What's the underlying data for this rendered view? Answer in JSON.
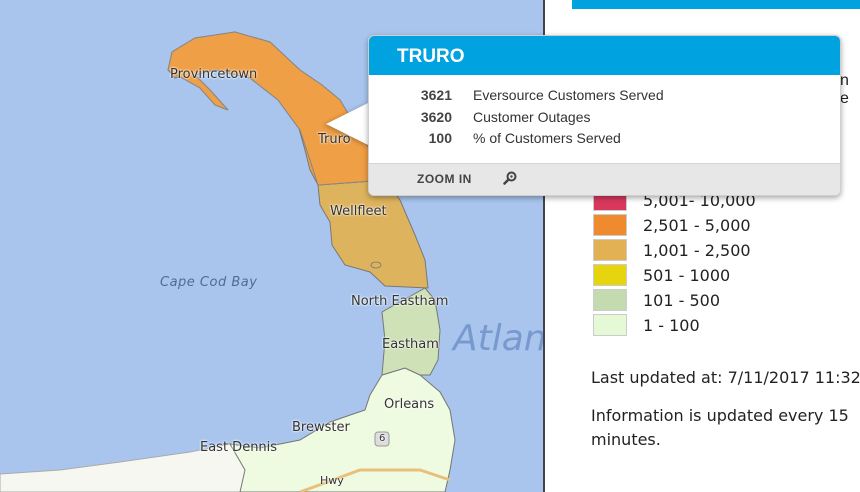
{
  "map": {
    "towns": [
      {
        "id": "provincetown",
        "label": "Provincetown"
      },
      {
        "id": "truro",
        "label": "Truro"
      },
      {
        "id": "wellfleet",
        "label": "Wellfleet"
      },
      {
        "id": "north-eastham",
        "label": "North Eastham"
      },
      {
        "id": "eastham",
        "label": "Eastham"
      },
      {
        "id": "orleans",
        "label": "Orleans"
      },
      {
        "id": "brewster",
        "label": "Brewster"
      },
      {
        "id": "east-dennis",
        "label": "East Dennis"
      }
    ],
    "water_label": "Cape Cod Bay",
    "ocean_label": "Atlan",
    "road_label": "6",
    "highway_label": "Hwy"
  },
  "popup": {
    "title": "TRURO",
    "stats": [
      {
        "value": "3621",
        "label": "Eversource Customers Served"
      },
      {
        "value": "3620",
        "label": "Customer Outages"
      },
      {
        "value": "100",
        "label": "% of Customers Served"
      }
    ],
    "zoom_label": "ZOOM IN",
    "zoom_icon": "magnifier-icon"
  },
  "panel": {
    "cut_text": "n e",
    "legend": [
      {
        "label": "5,001- 10,000",
        "color": "#d9385c"
      },
      {
        "label": "2,501 - 5,000",
        "color": "#ef8a2e"
      },
      {
        "label": "1,001 - 2,500",
        "color": "#e2b154"
      },
      {
        "label": "501 - 1000",
        "color": "#e6d40e"
      },
      {
        "label": "101 - 500",
        "color": "#c4dbb0"
      },
      {
        "label": "1 - 100",
        "color": "#e5f9d6"
      }
    ],
    "last_updated": "Last updated at: 7/11/2017 11:32",
    "update_note": "Information is updated every 15 minutes."
  },
  "colors": {
    "accent": "#00a2e0",
    "water": "#a9c5ee",
    "truro_fill": "#ef9f45",
    "wellfleet_fill": "#deb35d",
    "eastham_fill": "#cfe1b6",
    "lower_cape_fill": "#eefbe0",
    "mainland_fill": "#f7f7f2"
  }
}
